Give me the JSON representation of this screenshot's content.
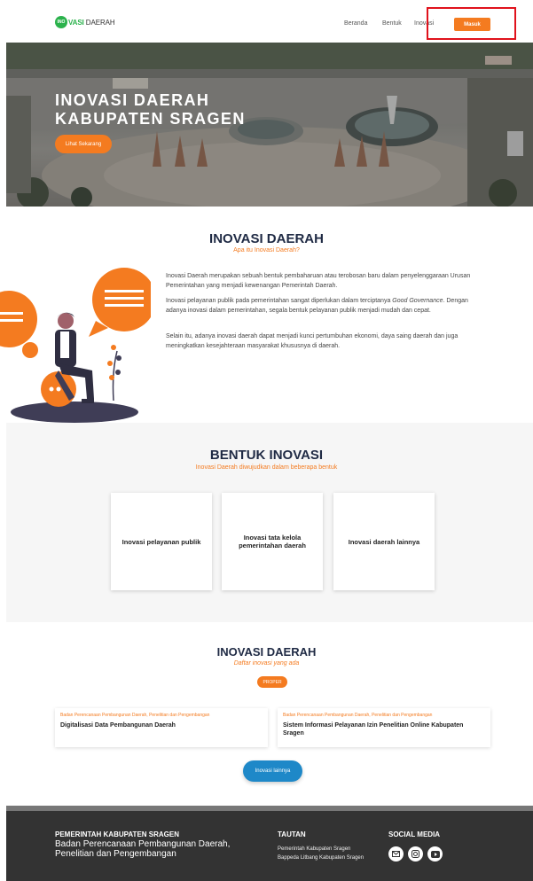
{
  "navbar": {
    "logo_mark": "INO",
    "logo_text_bold": "VASI",
    "logo_text": " DAERAH",
    "links": [
      "Beranda",
      "Bentuk",
      "Inovasi"
    ],
    "login_label": "Masuk"
  },
  "hero": {
    "title_line1": "INOVASI DAERAH",
    "title_line2": "KABUPATEN SRAGEN",
    "cta_label": "Lihat Sekarang"
  },
  "about": {
    "title": "INOVASI DAERAH",
    "subtitle": "Apa itu Inovasi Daerah?",
    "p1": "Inovasi Daerah merupakan sebuah bentuk pembaharuan atau terobosan baru dalam penyelenggaraan Urusan Pemerintahan yang menjadi kewenangan Pemerintah Daerah.",
    "p2_a": "Inovasi pelayanan publik pada pemerintahan sangat diperlukan dalam terciptanya ",
    "p2_em": "Good Governance",
    "p2_b": ". Dengan adanya inovasi dalam pemerintahan, segala bentuk pelayanan publik menjadi mudah dan cepat.",
    "p3": "Selain itu, adanya inovasi daerah dapat menjadi kunci pertumbuhan ekonomi, daya saing daerah dan juga meningkatkan kesejahteraan masyarakat khususnya di daerah."
  },
  "bentuk": {
    "title": "BENTUK INOVASI",
    "subtitle": "Inovasi Daerah diwujudkan dalam beberapa bentuk",
    "cards": [
      "Inovasi pelayanan publik",
      "Inovasi tata kelola pemerintahan daerah",
      "Inovasi daerah lainnya"
    ]
  },
  "daftar": {
    "title": "INOVASI DAERAH",
    "subtitle": "Daftar inovasi yang ada",
    "filter_label": "PROPER",
    "items": [
      {
        "org": "Badan Perencanaan Pembangunan Daerah, Penelitian dan Pengembangan",
        "title": "Digitalisasi Data Pembangunan Daerah"
      },
      {
        "org": "Badan Perencanaan Pembangunan Daerah, Penelitian dan Pengembangan",
        "title": "Sistem Informasi Pelayanan Izin Penelitian Online Kabupaten Sragen"
      }
    ],
    "more_label": "Inovasi lainnya"
  },
  "footer": {
    "org_head": "PEMERINTAH KABUPATEN SRAGEN",
    "org_line1": "Badan Perencanaan Pembangunan Daerah,",
    "org_line2": "Penelitian dan Pengembangan",
    "tautan_head": "TAUTAN",
    "tautan_links": [
      "Pemerintah Kabupaten Sragen",
      "Bappeda Litbang Kabupaten Sragen"
    ],
    "social_head": "SOCIAL MEDIA",
    "social_icons": [
      "mail-icon",
      "instagram-icon",
      "youtube-icon"
    ]
  },
  "colors": {
    "accent": "#f47b20",
    "brand_green": "#2bb24c",
    "button_blue": "#1e88c8",
    "footer_bg": "#333333",
    "highlight": "#e0121c"
  }
}
